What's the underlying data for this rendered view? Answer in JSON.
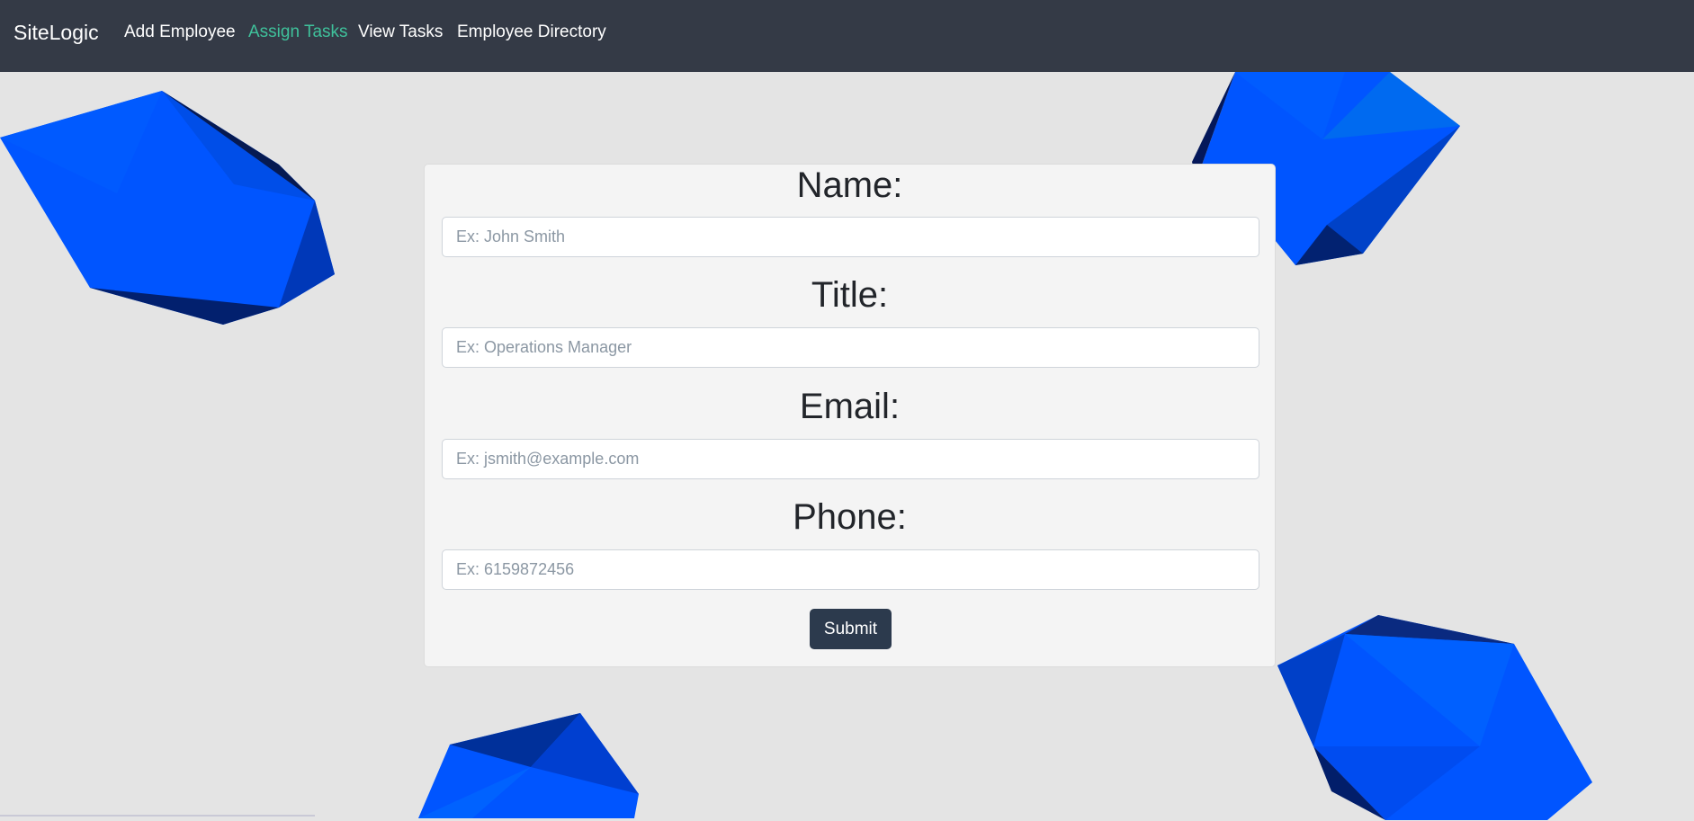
{
  "navbar": {
    "brand": "SiteLogic",
    "links": [
      {
        "label": "Add Employee",
        "active": false
      },
      {
        "label": "Assign Tasks",
        "active": true
      },
      {
        "label": "View Tasks",
        "active": false
      },
      {
        "label": "Employee Directory",
        "active": false
      }
    ]
  },
  "form": {
    "fields": [
      {
        "label": "Name:",
        "placeholder": "Ex: John Smith"
      },
      {
        "label": "Title:",
        "placeholder": "Ex: Operations Manager"
      },
      {
        "label": "Email:",
        "placeholder": "Ex: jsmith@example.com"
      },
      {
        "label": "Phone:",
        "placeholder": "Ex: 6159872456"
      }
    ],
    "submit_label": "Submit"
  },
  "colors": {
    "navbar_bg": "#343a46",
    "active_link": "#3fc19b",
    "gem_blue": "#0055ff",
    "button_bg": "#2c3a4d",
    "page_bg": "#e4e4e4"
  }
}
